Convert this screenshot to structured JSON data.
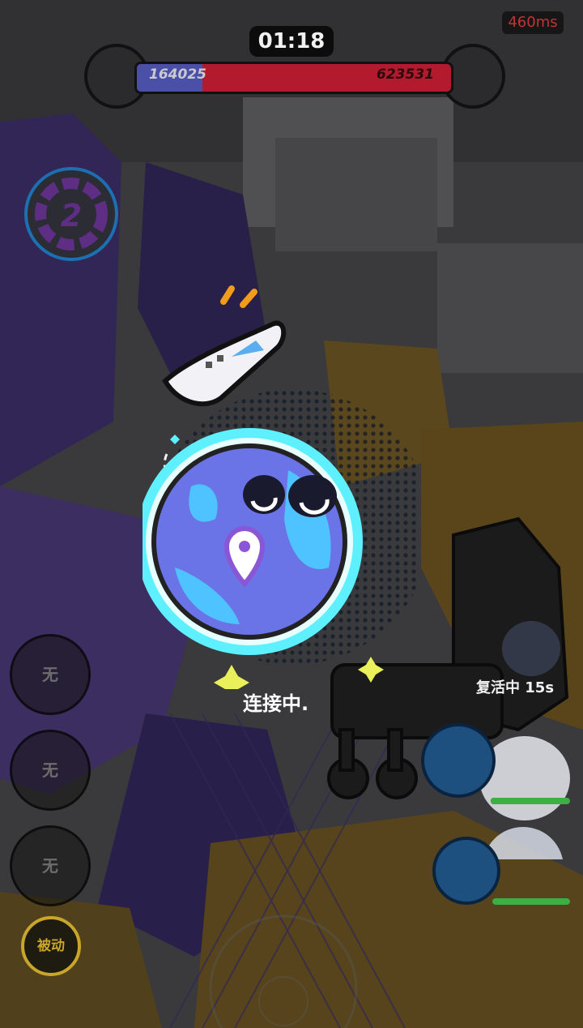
{
  "hud": {
    "timer": "01:18",
    "ping": "460ms",
    "blue_score": "164025",
    "red_score": "623531",
    "blue_share": 0.208
  },
  "wave_badge": {
    "number": "2"
  },
  "loading": {
    "text": "连接中."
  },
  "skills": [
    {
      "label": "无"
    },
    {
      "label": "无"
    },
    {
      "label": "无"
    }
  ],
  "passive": {
    "label": "被动"
  },
  "team": {
    "revive_text": "复活中 15s",
    "members": [
      {
        "hp": 1.0
      },
      {
        "hp": 1.0
      }
    ]
  },
  "colors": {
    "blue_team": "#4a50a8",
    "red_team": "#b31a2e",
    "planet": "#6a74e6",
    "planet_glow": "#5ef0ff",
    "ping": "#c03535"
  }
}
